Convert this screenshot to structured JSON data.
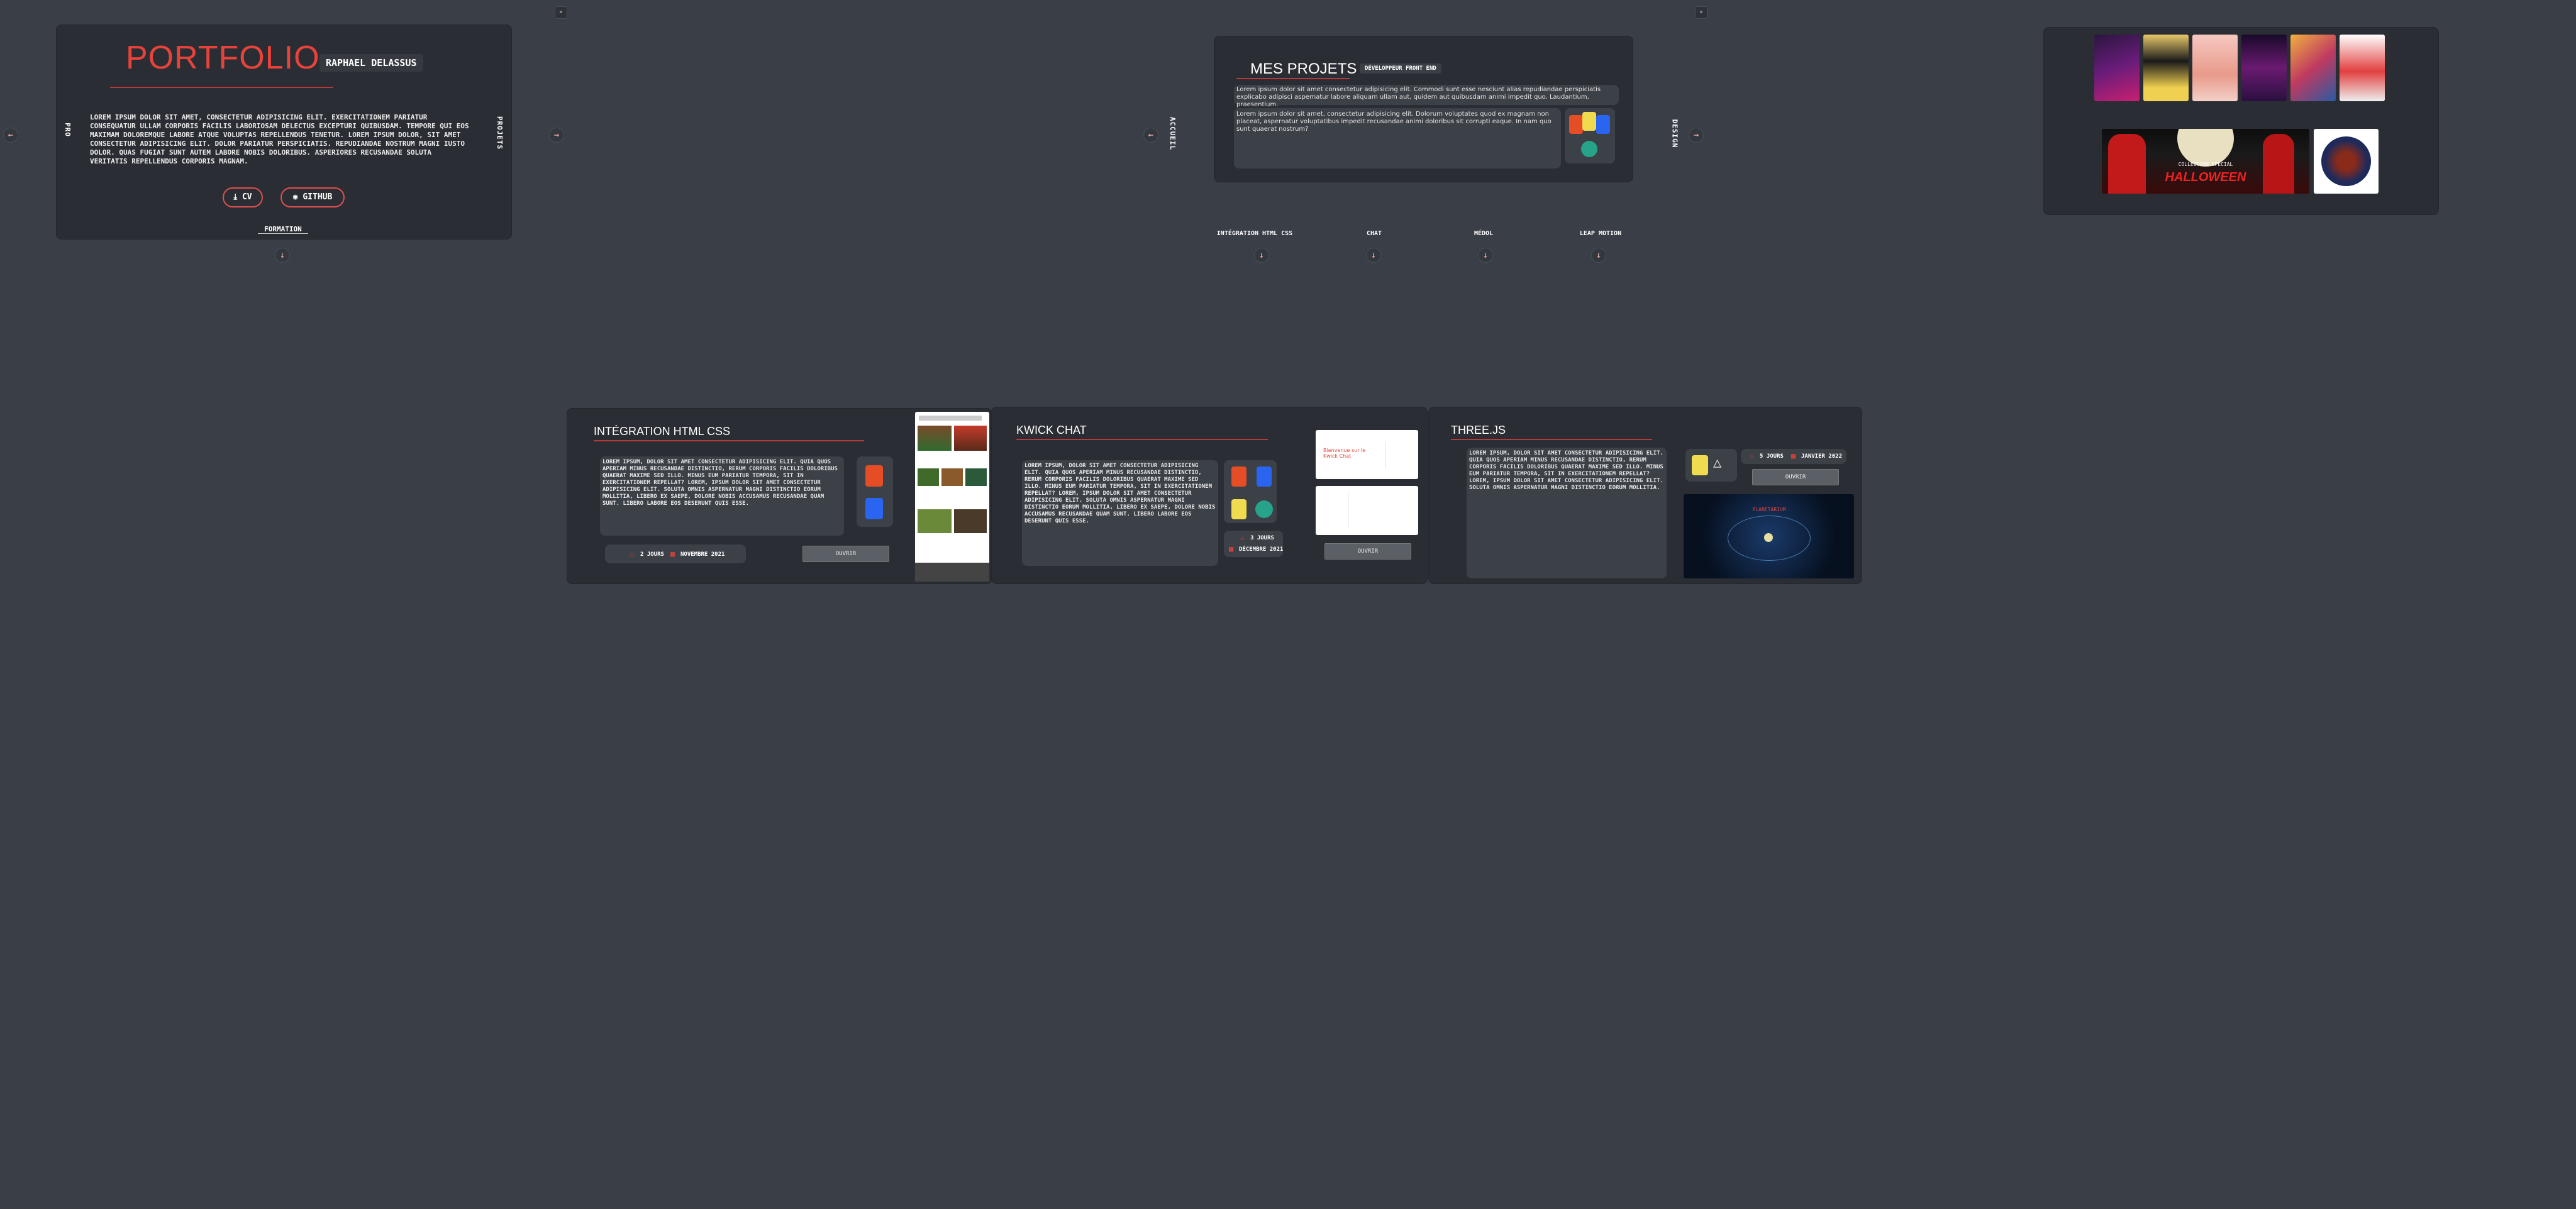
{
  "colors": {
    "bg": "#3a3f47",
    "panel": "#2a2d33",
    "accent": "#e8433a"
  },
  "nav": {
    "left_arrow": "←",
    "right_arrow": "→",
    "down_arrow": "↓",
    "close": "×"
  },
  "home": {
    "title": "PORTFOLIO",
    "name": "RAPHAEL DELASSUS",
    "text": "LOREM IPSUM DOLOR SIT AMET, CONSECTETUR ADIPISICING ELIT. EXERCITATIONEM PARIATUR CONSEQUATUR ULLAM CORPORIS FACILIS LABORIOSAM DELECTUS EXCEPTURI QUIBUSDAM. TEMPORE QUI EOS MAXIMAM DOLOREMQUE LABORE ATQUE VOLUPTAS REPELLENDUS TENETUR. LOREM IPSUM DOLOR, SIT AMET CONSECTETUR ADIPISICING ELIT. DOLOR PARIATUR PERSPICIATIS. REPUDIANDAE NOSTRUM MAGNI IUSTO DOLOR. QUAS FUGIAT SUNT AUTEM LABORE NOBIS DOLORIBUS. ASPERIORES RECUSANDAE SOLUTA VERITATIS REPELLENDUS CORPORIS MAGNAM.",
    "cv_label": "CV",
    "github_label": "GITHUB",
    "formation_label": "FORMATION",
    "left_side_label": "PROJETS",
    "right_side_label": "PROJETS"
  },
  "projects": {
    "title": "MES PROJETS",
    "badge": "DÉVELOPPEUR FRONT END",
    "intro": "Lorem ipsum dolor sit amet consectetur adipisicing elit. Commodi sunt esse nesciunt alias repudiandae perspiciatis explicabo adipisci aspernatur labore aliquam ullam aut, quidem aut quibusdam animi impedit quo. Laudantium, praesentium.",
    "body": "Lorem ipsum dolor sit amet, consectetur adipisicing elit. Dolorum voluptates quod ex magnam non placeat, aspernatur voluptatibus impedit recusandae animi doloribus sit corrupti eaque. In nam quo sunt quaerat nostrum?",
    "left_side_label": "ACCUEIL",
    "right_side_label": "DESIGN",
    "sub_labels": [
      "INTÉGRATION HTML CSS",
      "CHAT",
      "MÉDOL",
      "LEAP MOTION"
    ]
  },
  "design": {
    "right_side_label": "DESIGN"
  },
  "p1": {
    "title": "INTÉGRATION HTML CSS",
    "text": "LOREM IPSUM, DOLOR SIT AMET CONSECTETUR ADIPISICING ELIT. QUIA QUOS APERIAM MINUS RECUSANDAE DISTINCTIO, RERUM CORPORIS FACILIS DOLORIBUS QUAERAT MAXIME SED ILLO. MINUS EUM PARIATUR TEMPORA, SIT IN EXERCITATIONEM REPELLAT? LOREM, IPSUM DOLOR SIT AMET CONSECTETUR ADIPISICING ELIT. SOLUTA OMNIS ASPERNATUR MAGNI DISTINCTIO EORUM MOLLITIA, LIBERO EX SAEPE, DOLORE NOBIS ACCUSAMUS RECUSANDAE QUAM SUNT. LIBERO LABORE EOS DESERUNT QUIS ESSE.",
    "duration": "2 JOURS",
    "date": "NOVEMBRE 2021",
    "button": "OUVRIR"
  },
  "p2": {
    "title": "KWICK CHAT",
    "text": "LOREM IPSUM, DOLOR SIT AMET CONSECTETUR ADIPISICING ELIT. QUIA QUOS APERIAM MINUS RECUSANDAE DISTINCTIO, RERUM CORPORIS FACILIS DOLORIBUS QUAERAT MAXIME SED ILLO. MINUS EUM PARIATUR TEMPORA, SIT IN EXERCITATIONEM REPELLAT? LOREM, IPSUM DOLOR SIT AMET CONSECTETUR ADIPISICING ELIT. SOLUTA OMNIS ASPERNATUR MAGNI DISTINCTIO EORUM MOLLITIA, LIBERO EX SAEPE, DOLORE NOBIS ACCUSAMUS RECUSANDAE QUAM SUNT. LIBERO LABORE EOS DESERUNT QUIS ESSE.",
    "duration": "3 JOURS",
    "date": "DÉCEMBRE 2021",
    "button": "OUVRIR",
    "screen_text": "Bienvenue sur le Kwick Chat"
  },
  "p3": {
    "title": "THREE.JS",
    "text": "LOREM IPSUM, DOLOR SIT AMET CONSECTETUR ADIPISICING ELIT. QUIA QUOS APERIAM MINUS RECUSANDAE DISTINCTIO, RERUM CORPORIS FACILIS DOLORIBUS QUAERAT MAXIME SED ILLO. MINUS EUM PARIATUR TEMPORA, SIT IN EXERCITATIONEM REPELLAT? LOREM, IPSUM DOLOR SIT AMET CONSECTETUR ADIPISICING ELIT. SOLUTA OMNIS ASPERNATUR MAGNI DISTINCTIO EORUM MOLLITIA.",
    "duration": "5 JOURS",
    "date": "JANVIER 2022",
    "button": "OUVRIR",
    "screen_title": "PLANETARIUM"
  },
  "design_thumbs": {
    "collection_text": "COLLECTION SPÉCIAL",
    "halloween_text": "HALLOWEEN"
  }
}
